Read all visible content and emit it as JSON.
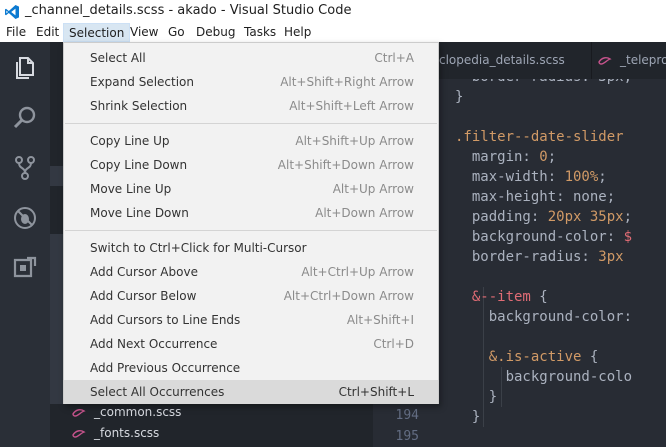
{
  "window": {
    "title": "_channel_details.scss - akado - Visual Studio Code"
  },
  "menubar": {
    "items": [
      {
        "label": "File"
      },
      {
        "label": "Edit"
      },
      {
        "label": "Selection"
      },
      {
        "label": "View"
      },
      {
        "label": "Go"
      },
      {
        "label": "Debug"
      },
      {
        "label": "Tasks"
      },
      {
        "label": "Help"
      }
    ]
  },
  "selection_menu": {
    "groups": [
      [
        {
          "label": "Select All",
          "shortcut": "Ctrl+A"
        },
        {
          "label": "Expand Selection",
          "shortcut": "Alt+Shift+Right Arrow"
        },
        {
          "label": "Shrink Selection",
          "shortcut": "Alt+Shift+Left Arrow"
        }
      ],
      [
        {
          "label": "Copy Line Up",
          "shortcut": "Alt+Shift+Up Arrow"
        },
        {
          "label": "Copy Line Down",
          "shortcut": "Alt+Shift+Down Arrow"
        },
        {
          "label": "Move Line Up",
          "shortcut": "Alt+Up Arrow"
        },
        {
          "label": "Move Line Down",
          "shortcut": "Alt+Down Arrow"
        }
      ],
      [
        {
          "label": "Switch to Ctrl+Click for Multi-Cursor",
          "shortcut": ""
        },
        {
          "label": "Add Cursor Above",
          "shortcut": "Alt+Ctrl+Up Arrow"
        },
        {
          "label": "Add Cursor Below",
          "shortcut": "Alt+Ctrl+Down Arrow"
        },
        {
          "label": "Add Cursors to Line Ends",
          "shortcut": "Alt+Shift+I"
        },
        {
          "label": "Add Next Occurrence",
          "shortcut": "Ctrl+D"
        },
        {
          "label": "Add Previous Occurrence",
          "shortcut": ""
        },
        {
          "label": "Select All Occurrences",
          "shortcut": "Ctrl+Shift+L",
          "highlighted": true
        }
      ]
    ]
  },
  "sidebar": {
    "files": [
      {
        "name": "_common.scss"
      },
      {
        "name": "_fonts.scss"
      }
    ]
  },
  "editor": {
    "tabs": [
      {
        "label": "clopedia_details.scss"
      },
      {
        "label": "_teleprog"
      }
    ],
    "line_numbers": [
      "194",
      "195"
    ],
    "lines": [
      [
        {
          "t": "  border-radius: 3px;",
          "c": "#abb2bf"
        }
      ],
      [
        {
          "t": "}",
          "c": "#abb2bf"
        }
      ],
      [
        {
          "t": "",
          "c": "#abb2bf"
        }
      ],
      [
        {
          "t": ".filter--date-slider",
          "c": "#d19a66"
        }
      ],
      [
        {
          "t": "  margin: ",
          "c": "#abb2bf"
        },
        {
          "t": "0",
          "c": "#d19a66"
        },
        {
          "t": ";",
          "c": "#abb2bf"
        }
      ],
      [
        {
          "t": "  max-width: ",
          "c": "#abb2bf"
        },
        {
          "t": "100%",
          "c": "#d19a66"
        },
        {
          "t": ";",
          "c": "#abb2bf"
        }
      ],
      [
        {
          "t": "  max-height: none;",
          "c": "#abb2bf"
        }
      ],
      [
        {
          "t": "  padding: ",
          "c": "#abb2bf"
        },
        {
          "t": "20px 35px",
          "c": "#d19a66"
        },
        {
          "t": ";",
          "c": "#abb2bf"
        }
      ],
      [
        {
          "t": "  background-color: ",
          "c": "#abb2bf"
        },
        {
          "t": "$",
          "c": "#e06c75"
        }
      ],
      [
        {
          "t": "  border-radius: ",
          "c": "#abb2bf"
        },
        {
          "t": "3px",
          "c": "#d19a66"
        }
      ],
      [
        {
          "t": "",
          "c": "#abb2bf"
        }
      ],
      [
        {
          "t": "  &--item",
          "c": "#e06c75"
        },
        {
          "t": " {",
          "c": "#abb2bf"
        }
      ],
      [
        {
          "t": "    background-color:",
          "c": "#abb2bf"
        }
      ],
      [
        {
          "t": "",
          "c": "#abb2bf"
        }
      ],
      [
        {
          "t": "    &.is-active",
          "c": "#d19a66"
        },
        {
          "t": " {",
          "c": "#abb2bf"
        }
      ],
      [
        {
          "t": "      background-colo",
          "c": "#abb2bf"
        }
      ],
      [
        {
          "t": "    }",
          "c": "#abb2bf"
        }
      ],
      [
        {
          "t": "  }",
          "c": "#abb2bf"
        }
      ]
    ]
  },
  "colors": {
    "accent": "#d19a66",
    "keyword": "#e06c75",
    "menu_highlight": "#dadada",
    "sass_pink": "#c6538c"
  }
}
